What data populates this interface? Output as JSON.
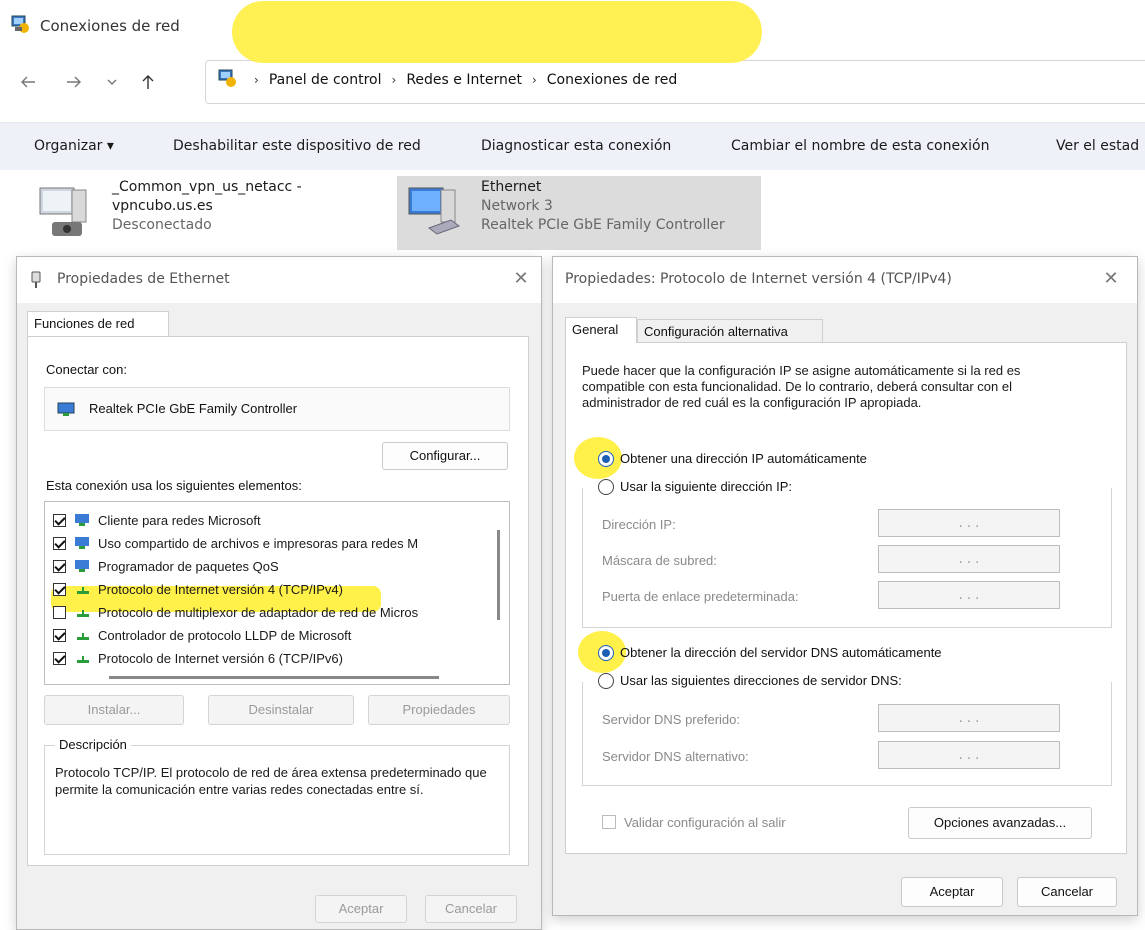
{
  "window": {
    "title": "Conexiones de red",
    "breadcrumb": [
      "Panel de control",
      "Redes e Internet",
      "Conexiones de red"
    ],
    "breadcrumb_separator": "›"
  },
  "toolbar": {
    "organize": "Organizar ▾",
    "disable": "Deshabilitar este dispositivo de red",
    "diagnose": "Diagnosticar esta conexión",
    "rename": "Cambiar el nombre de esta conexión",
    "status": "Ver el estad"
  },
  "connections": [
    {
      "name": "_Common_vpn_us_netacc -",
      "line2": "vpncubo.us.es",
      "line3": "Desconectado"
    },
    {
      "name": "Ethernet",
      "line2": "Network 3",
      "line3": "Realtek PCIe GbE Family Controller"
    }
  ],
  "ethernet_dialog": {
    "title": "Propiedades de Ethernet",
    "tab": "Funciones de red",
    "connect_using_label": "Conectar con:",
    "adapter": "Realtek PCIe GbE Family Controller",
    "configure_button": "Configurar...",
    "items_label": "Esta conexión usa los siguientes elementos:",
    "items": [
      {
        "label": "Cliente para redes Microsoft",
        "checked": true
      },
      {
        "label": "Uso compartido de archivos e impresoras para redes M",
        "checked": true
      },
      {
        "label": "Programador de paquetes QoS",
        "checked": true
      },
      {
        "label": "Protocolo de Internet versión 4 (TCP/IPv4)",
        "checked": true
      },
      {
        "label": "Protocolo de multiplexor de adaptador de red de Micros",
        "checked": false
      },
      {
        "label": "Controlador de protocolo LLDP de Microsoft",
        "checked": true
      },
      {
        "label": "Protocolo de Internet versión 6 (TCP/IPv6)",
        "checked": true
      }
    ],
    "install_button": "Instalar...",
    "uninstall_button": "Desinstalar",
    "properties_button": "Propiedades",
    "description_label": "Descripción",
    "description_text": "Protocolo TCP/IP. El protocolo de red de área extensa predeterminado que permite la comunicación entre varias redes conectadas entre sí.",
    "ok_button": "Aceptar",
    "cancel_button": "Cancelar"
  },
  "ipv4_dialog": {
    "title": "Propiedades: Protocolo de Internet versión 4 (TCP/IPv4)",
    "tab_general": "General",
    "tab_alternate": "Configuración alternativa",
    "intro": "Puede hacer que la configuración IP se asigne automáticamente si la red es compatible con esta funcionalidad. De lo contrario, deberá consultar con el administrador de red cuál es la configuración IP apropiada.",
    "auto_ip": "Obtener una dirección IP automáticamente",
    "manual_ip": "Usar la siguiente dirección IP:",
    "ip_address": "Dirección IP:",
    "subnet": "Máscara de subred:",
    "gateway": "Puerta de enlace predeterminada:",
    "auto_dns": "Obtener la dirección del servidor DNS automáticamente",
    "manual_dns": "Usar las siguientes direcciones de servidor DNS:",
    "preferred_dns": "Servidor DNS preferido:",
    "alternate_dns": "Servidor DNS alternativo:",
    "validate": "Validar configuración al salir",
    "advanced_button": "Opciones avanzadas...",
    "ok_button": "Aceptar",
    "cancel_button": "Cancelar",
    "ip_placeholder": ".   .   ."
  },
  "colors": {
    "highlight": "#fff04a",
    "accent": "#1a5fb4"
  }
}
